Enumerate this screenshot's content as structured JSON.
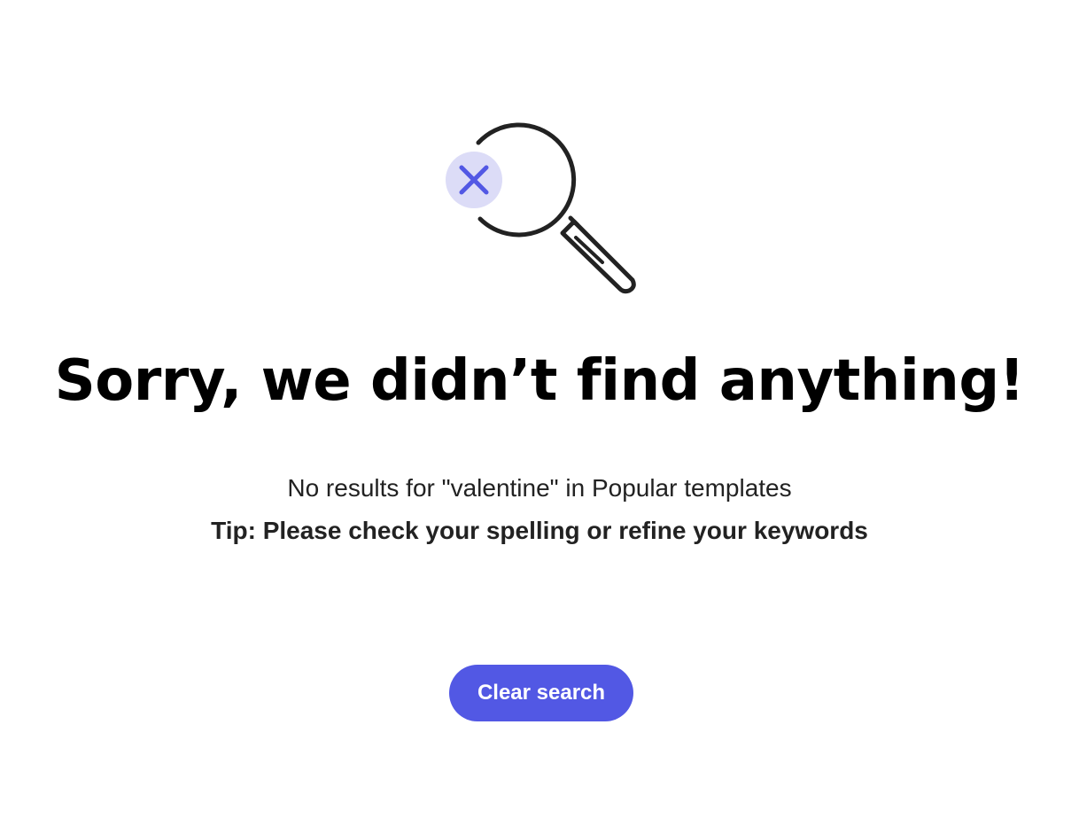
{
  "illustration": {
    "icon": "search-no-results-icon",
    "accent_color": "#5258e4",
    "badge_color": "#dcdcf7"
  },
  "empty_state": {
    "title": "Sorry, we didn’t find anything!",
    "message": "No results for \"valentine\" in Popular templates",
    "tip": "Tip: Please check your spelling or refine your keywords"
  },
  "actions": {
    "clear_search_label": "Clear search"
  }
}
